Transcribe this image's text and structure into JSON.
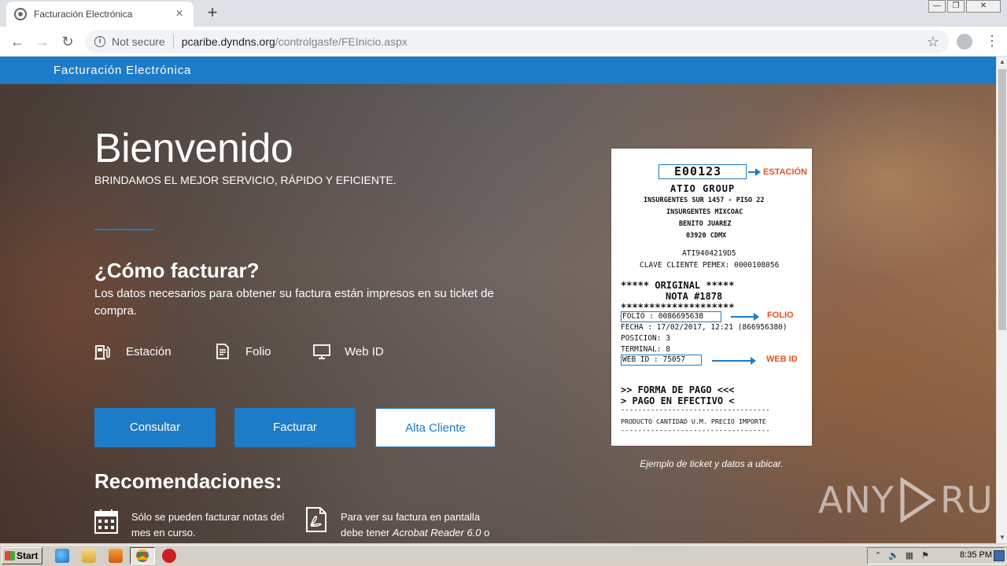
{
  "browser": {
    "tab_title": "Facturación Electrónica",
    "tab_close": "×",
    "new_tab": "+",
    "security_label": "Not secure",
    "url_host": "pcaribe.dyndns.org",
    "url_path": "/controlgasfe/FEInicio.aspx",
    "back": "←",
    "forward": "→",
    "reload": "↻",
    "star": "☆",
    "menu": "⋮",
    "win_min": "—",
    "win_max": "❐",
    "win_close": "✕"
  },
  "site": {
    "brand": "Facturación Electrónica"
  },
  "hero": {
    "title": "Bienvenido",
    "subtitle": "BRINDAMOS EL MEJOR SERVICIO, RÁPIDO Y EFICIENTE.",
    "how_title": "¿Cómo facturar?",
    "how_text": "Los datos necesarios para obtener su factura están impresos en su ticket de compra.",
    "data_items": [
      {
        "label": "Estación",
        "icon": "gas-station-icon"
      },
      {
        "label": "Folio",
        "icon": "document-icon"
      },
      {
        "label": "Web ID",
        "icon": "monitor-icon"
      }
    ],
    "buttons": {
      "consultar": "Consultar",
      "facturar": "Facturar",
      "alta_cliente": "Alta Cliente"
    },
    "reco_title": "Recomendaciones:",
    "reco_1": "Sólo se pueden facturar notas del mes en curso.",
    "reco_2_a": "Para ver su factura en pantalla debe tener ",
    "reco_2_b": "Acrobat Reader 6.0",
    "reco_2_c": " o posterior (Descargar)."
  },
  "ticket": {
    "estacion_code": "E00123",
    "estacion_callout": "ESTACIÓN",
    "company": "ATIO GROUP",
    "addr1": "INSURGENTES SUR 1457 - PISO 22",
    "addr2": "INSURGENTES MIXCOAC",
    "addr3": "BENITO JUAREZ",
    "addr4": "03920 CDMX",
    "rfc": "ATI9404219D5",
    "clave": "CLAVE CLIENTE PEMEX: 0000108056",
    "original": "***** ORIGINAL *****",
    "nota": "NOTA #1878",
    "stars": "********************",
    "folio": "FOLIO   : 0086695638",
    "folio_callout": "FOLIO",
    "fecha": "FECHA   : 17/02/2017, 12:21 (866956380)",
    "posicion": "POSICION: 3",
    "terminal": "TERMINAL: 8",
    "webid": "WEB ID  : 75057",
    "webid_callout": "WEB ID",
    "forma1": ">> FORMA DE PAGO <<<",
    "forma2": "> PAGO EN EFECTIVO <",
    "dashes": "-----------------------------------",
    "columns": "PRODUCTO CANTIDAD U.M. PRECIO    IMPORTE",
    "caption": "Ejemplo de ticket y datos a ubicar."
  },
  "watermark": {
    "left": "ANY",
    "right": "RUN"
  },
  "taskbar": {
    "start": "Start",
    "clock": "8:35 PM"
  }
}
